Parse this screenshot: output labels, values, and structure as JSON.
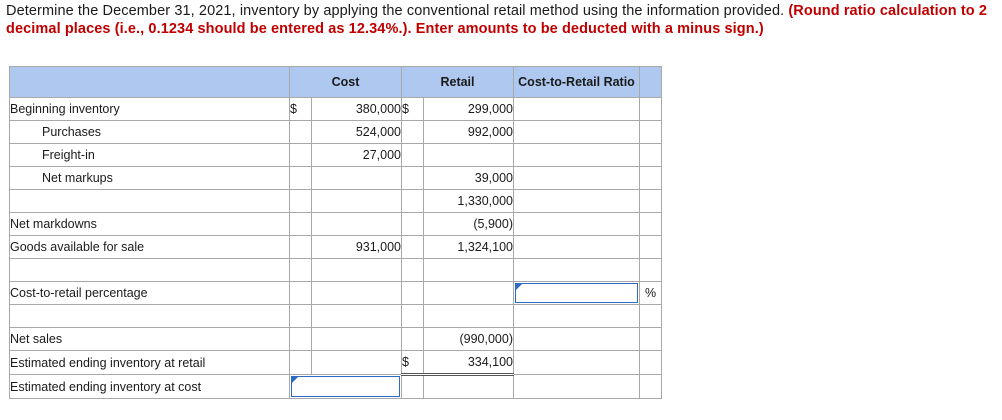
{
  "instructions": {
    "text": "Determine the December 31, 2021, inventory by applying the conventional retail method using the information provided. ",
    "emphasis": "(Round ratio calculation to 2 decimal places (i.e., 0.1234 should be entered as 12.34%.). Enter amounts to be deducted with a minus sign.)"
  },
  "headers": {
    "cost": "Cost",
    "retail": "Retail",
    "ratio": "Cost-to-Retail Ratio"
  },
  "rows": {
    "beginning_inventory": {
      "label": "Beginning inventory",
      "cost_currency": "$",
      "cost": "380,000",
      "retail_currency": "$",
      "retail": "299,000"
    },
    "purchases": {
      "label": "Purchases",
      "cost": "524,000",
      "retail": "992,000"
    },
    "freight_in": {
      "label": "Freight-in",
      "cost": "27,000"
    },
    "net_markups": {
      "label": "Net markups",
      "retail": "39,000"
    },
    "subtotal": {
      "retail": "1,330,000"
    },
    "net_markdowns": {
      "label": "Net markdowns",
      "retail": "(5,900)"
    },
    "goods_available": {
      "label": "Goods available for sale",
      "cost": "931,000",
      "retail": "1,324,100"
    },
    "cost_to_retail": {
      "label": "Cost-to-retail percentage",
      "ratio_value": "",
      "pct_sign": "%"
    },
    "net_sales": {
      "label": "Net sales",
      "retail": "(990,000)"
    },
    "est_retail": {
      "label": "Estimated ending inventory at retail",
      "retail_currency": "$",
      "retail": "334,100"
    },
    "est_cost": {
      "label": "Estimated ending inventory at cost",
      "cost_value": ""
    }
  }
}
